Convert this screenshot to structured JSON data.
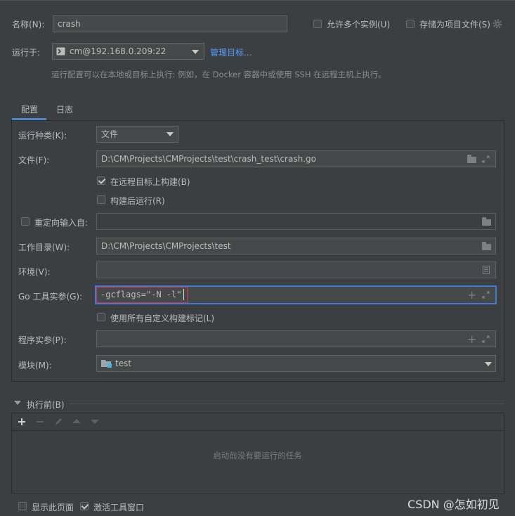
{
  "header": {
    "name_label": "名称(N):",
    "name_value": "crash",
    "allow_multiple_label": "允许多个实例(U)",
    "store_as_project_label": "存储为项目文件(S)",
    "run_on_label": "运行于:",
    "run_on_value": "cm@192.168.0.209:22",
    "manage_targets_label": "管理目标...",
    "hint": "运行配置可以在本地或目标上执行: 例如，在 Docker 容器中或使用 SSH 在远程主机上执行。"
  },
  "tabs": [
    {
      "label": "配置",
      "active": true
    },
    {
      "label": "日志",
      "active": false
    }
  ],
  "config": {
    "run_kind_label": "运行种类(K):",
    "run_kind_value": "文件",
    "file_label": "文件(F):",
    "file_value": "D:\\CM\\Projects\\CMProjects\\test\\crash_test\\crash.go",
    "build_on_remote_label": "在远程目标上构建(B)",
    "build_on_remote_checked": true,
    "run_after_build_label": "构建后运行(R)",
    "run_after_build_checked": false,
    "redirect_input_label": "重定向输入自:",
    "redirect_input_value": "",
    "workdir_label": "工作目录(W):",
    "workdir_value": "D:\\CM\\Projects\\CMProjects\\test",
    "env_label": "环境(V):",
    "env_value": "",
    "go_tool_args_label": "Go 工具实参(G):",
    "go_tool_args_value": "-gcflags=\"-N -l\"",
    "use_custom_tags_label": "使用所有自定义构建标记(L)",
    "program_args_label": "程序实参(P):",
    "program_args_value": "",
    "module_label": "模块(M):",
    "module_value": "test"
  },
  "before_launch": {
    "title": "执行前(B)",
    "empty_text": "启动前没有要运行的任务"
  },
  "footer": {
    "show_page_label": "显示此页面",
    "activate_window_label": "激活工具窗口",
    "activate_window_checked": true,
    "watermark": "CSDN @怎如初见"
  },
  "colors": {
    "background": "#3c3f41",
    "field": "#45494a",
    "accent_link": "#589df6",
    "focus_border": "#3d7bd6",
    "highlight_red": "#e0303b"
  },
  "icons": [
    "gear-icon",
    "terminal-icon",
    "folder-icon",
    "expand-icon",
    "plus-icon",
    "document-icon",
    "module-folder-icon",
    "minus-icon",
    "edit-icon",
    "up-icon",
    "down-icon",
    "collapse-triangle-icon"
  ]
}
